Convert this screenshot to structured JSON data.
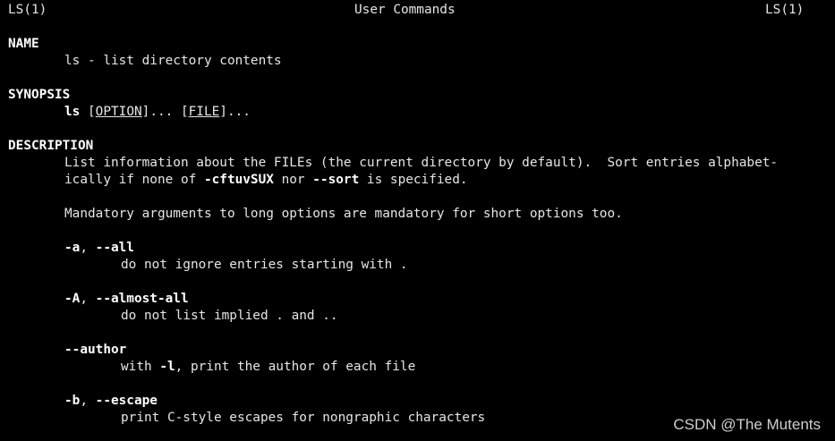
{
  "header": {
    "left": "LS(1)",
    "center": "User Commands",
    "right": "LS(1)"
  },
  "name_section": {
    "heading": "NAME",
    "text": "ls - list directory contents"
  },
  "synopsis_section": {
    "heading": "SYNOPSIS",
    "cmd": "ls",
    "sp1": " ",
    "option": "OPTION",
    "after_option": "]... [",
    "file": "FILE",
    "after_file": "]..."
  },
  "description_section": {
    "heading": "DESCRIPTION",
    "p1_a": "List information about the FILEs (the current directory by default).  Sort entries alphabet-",
    "p1_b1": "ically if none of ",
    "p1_flags": "-cftuvSUX",
    "p1_b2": " nor ",
    "p1_sort": "--sort",
    "p1_b3": " is specified.",
    "p2": "Mandatory arguments to long options are mandatory for short options too."
  },
  "options": [
    {
      "short": "-a",
      "sep": ", ",
      "long": "--all",
      "desc": "do not ignore entries starting with ."
    },
    {
      "short": "-A",
      "sep": ", ",
      "long": "--almost-all",
      "desc": "do not list implied . and .."
    },
    {
      "long": "--author",
      "desc_a": "with ",
      "desc_flag": "-l",
      "desc_b": ", print the author of each file"
    },
    {
      "short": "-b",
      "sep": ", ",
      "long": "--escape",
      "desc": "print C-style escapes for nongraphic characters"
    }
  ],
  "watermark": "CSDN @The Mutents",
  "colors": {
    "background": "#000000",
    "text": "#e6e6e6",
    "bold_text": "#ffffff"
  }
}
